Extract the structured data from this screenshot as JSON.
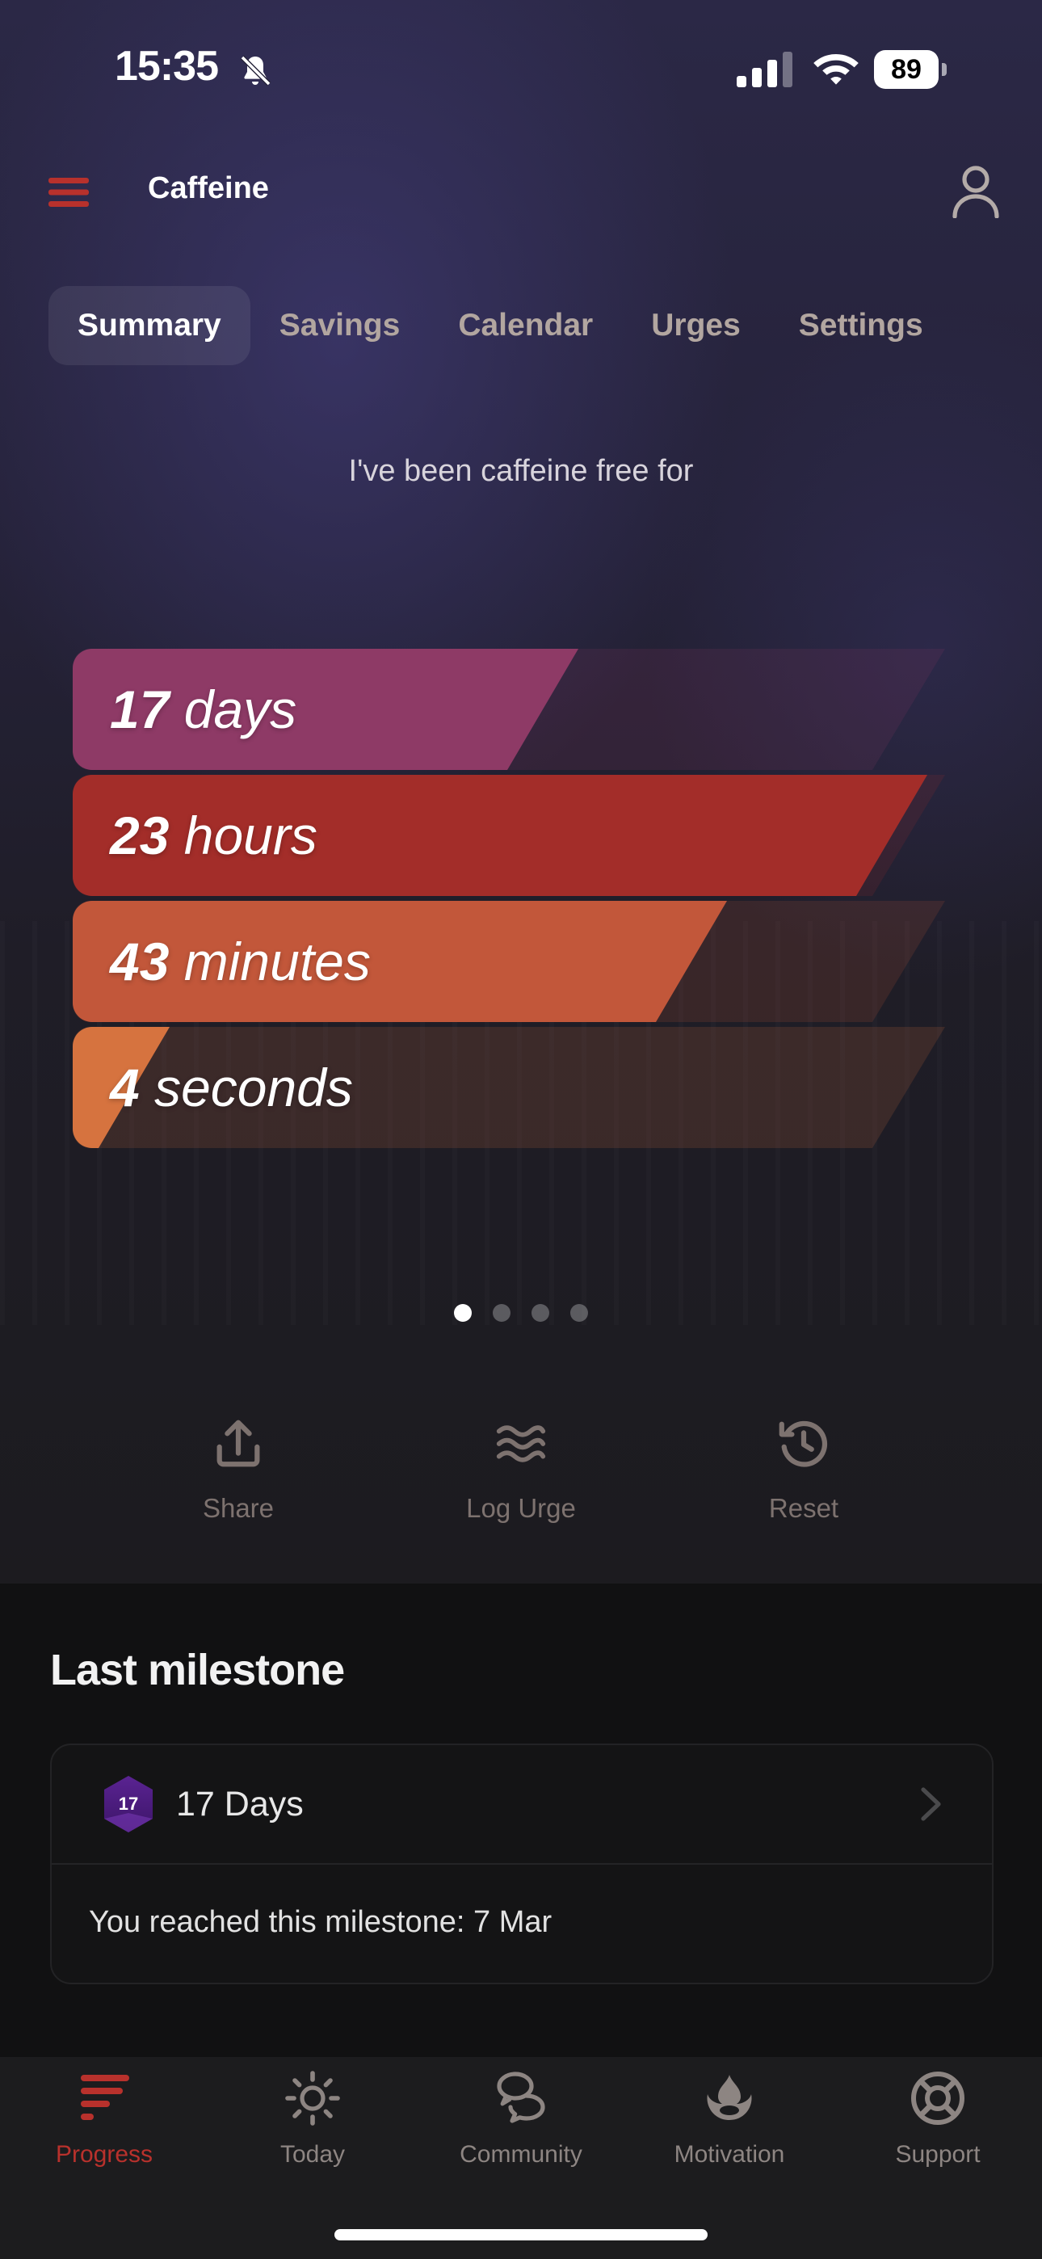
{
  "status_bar": {
    "time": "15:35",
    "battery": "89"
  },
  "header": {
    "title": "Caffeine"
  },
  "tabs": [
    {
      "label": "Summary",
      "active": true
    },
    {
      "label": "Savings",
      "active": false
    },
    {
      "label": "Calendar",
      "active": false
    },
    {
      "label": "Urges",
      "active": false
    },
    {
      "label": "Settings",
      "active": false
    }
  ],
  "summary": {
    "subtitle": "I've been caffeine free for",
    "counters": [
      {
        "value": "17",
        "unit": "days",
        "fill": 0.58,
        "color": "#8e3a66"
      },
      {
        "value": "23",
        "unit": "hours",
        "fill": 0.98,
        "color": "#a32d29"
      },
      {
        "value": "43",
        "unit": "minutes",
        "fill": 0.75,
        "color": "#c2573a"
      },
      {
        "value": "4",
        "unit": "seconds",
        "fill": 0.07,
        "color": "#d6733f"
      }
    ],
    "pager": {
      "pages": 4,
      "current": 1
    }
  },
  "actions": [
    {
      "label": "Share",
      "icon": "share-icon"
    },
    {
      "label": "Log Urge",
      "icon": "waves-icon"
    },
    {
      "label": "Reset",
      "icon": "history-icon"
    }
  ],
  "milestone": {
    "section_title": "Last milestone",
    "badge_number": "17",
    "name": "17 Days",
    "reached_text": "You reached this milestone: 7 Mar"
  },
  "bottom_nav": [
    {
      "label": "Progress",
      "icon": "progress-icon",
      "active": true
    },
    {
      "label": "Today",
      "icon": "sun-icon",
      "active": false
    },
    {
      "label": "Community",
      "icon": "chat-bubbles-icon",
      "active": false
    },
    {
      "label": "Motivation",
      "icon": "flame-icon",
      "active": false
    },
    {
      "label": "Support",
      "icon": "lifebuoy-icon",
      "active": false
    }
  ],
  "colors": {
    "accent": "#b8312c",
    "background": "#111112"
  }
}
